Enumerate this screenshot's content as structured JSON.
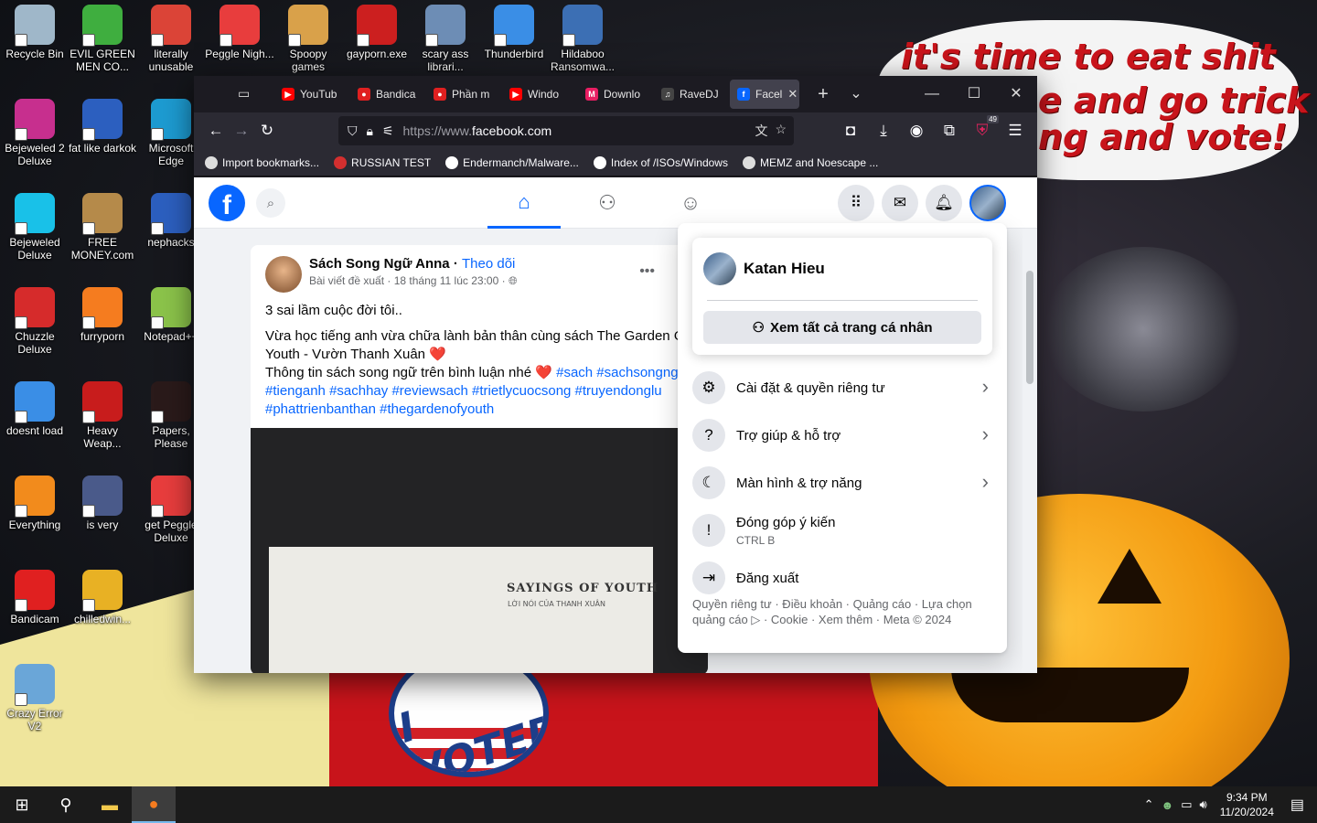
{
  "wallpaper": {
    "lines": [
      "it's time to eat shit",
      "e and go trick",
      "ng and vote!"
    ],
    "voted": "I VOTED"
  },
  "desktop": {
    "icons": [
      {
        "label": "Recycle Bin",
        "icon": "recycle-bin-icon",
        "color": "#9fb7c9"
      },
      {
        "label": "EVIL GREEN MEN CO...",
        "icon": "green-men-icon",
        "color": "#3fae3f"
      },
      {
        "label": "literally unusable",
        "icon": "chrome-icon",
        "color": "#db4437"
      },
      {
        "label": "Peggle Nigh...",
        "icon": "peggle-icon",
        "color": "#e83d3d"
      },
      {
        "label": "Spoopy games",
        "icon": "folder-icon",
        "color": "#d9a14a"
      },
      {
        "label": "gayporn.exe",
        "icon": "flash-icon",
        "color": "#cc1f1f"
      },
      {
        "label": "scary ass librari...",
        "icon": "shield-icon",
        "color": "#6d8db5"
      },
      {
        "label": "Thunderbird",
        "icon": "thunderbird-icon",
        "color": "#3a8ee6"
      },
      {
        "label": "Hildaboo Ransomwa...",
        "icon": "shield-icon",
        "color": "#3c6fb4"
      },
      {
        "label": "Bejeweled 2 Deluxe",
        "icon": "bejeweled-icon",
        "color": "#c72f8e"
      },
      {
        "label": "fat like darkok",
        "icon": "mpi-icon",
        "color": "#2c5fbf"
      },
      {
        "label": "Microsoft Edge",
        "icon": "edge-icon",
        "color": "#1d9bd1"
      },
      {
        "label": "Bejeweled Deluxe",
        "icon": "gem-icon",
        "color": "#19c1e8"
      },
      {
        "label": "FREE MONEY.com",
        "icon": "money-bag-icon",
        "color": "#b58a4a"
      },
      {
        "label": "nephacks",
        "icon": "mpi-icon",
        "color": "#2c5fbf"
      },
      {
        "label": "Chuzzle Deluxe",
        "icon": "chuzzle-icon",
        "color": "#d62b2b"
      },
      {
        "label": "furryporn",
        "icon": "firefox-icon",
        "color": "#f57c1f"
      },
      {
        "label": "Notepad++",
        "icon": "notepad-icon",
        "color": "#8bc34a"
      },
      {
        "label": "doesnt load",
        "icon": "thunderbird-icon",
        "color": "#3a8ee6"
      },
      {
        "label": "Heavy Weap...",
        "icon": "radiation-icon",
        "color": "#c81c1c"
      },
      {
        "label": "Papers, Please",
        "icon": "papers-please-icon",
        "color": "#2a1a1a"
      },
      {
        "label": "Everything",
        "icon": "magnifier-icon",
        "color": "#f28b1c"
      },
      {
        "label": "is very",
        "icon": "mpi-icon",
        "color": "#4a5a8a"
      },
      {
        "label": "get Peggle Deluxe",
        "icon": "peggle-icon",
        "color": "#e83d3d"
      },
      {
        "label": "Bandicam",
        "icon": "record-icon",
        "color": "#e02020"
      },
      {
        "label": "chilledwin...",
        "icon": "windows-logo-icon",
        "color": "#e8b124"
      },
      {
        "label": "Crazy Error V2",
        "icon": "error-window-icon",
        "color": "#6aa6d8"
      }
    ]
  },
  "browser": {
    "tabs": [
      {
        "label": "YouTub",
        "fav": "#ff0000",
        "glyph": "▶"
      },
      {
        "label": "Bandica",
        "fav": "#e02020",
        "glyph": "●"
      },
      {
        "label": "Phần m",
        "fav": "#e02020",
        "glyph": "●"
      },
      {
        "label": "Windo",
        "fav": "#ff0000",
        "glyph": "▶"
      },
      {
        "label": "Downlo",
        "fav": "#e91e63",
        "glyph": "M"
      },
      {
        "label": "RaveDJ",
        "fav": "#444444",
        "glyph": "♫"
      },
      {
        "label": "Facel",
        "fav": "#0866ff",
        "glyph": "f"
      }
    ],
    "url_prefix": "https://www.",
    "url_domain": "facebook.com",
    "badge": "49",
    "bookmarks": [
      {
        "label": "Import bookmarks...",
        "color": "#dddddd"
      },
      {
        "label": "RUSSIAN TEST",
        "color": "#d32f2f"
      },
      {
        "label": "Endermanch/Malware...",
        "color": "#ffffff"
      },
      {
        "label": "Index of /ISOs/Windows",
        "color": "#ffffff"
      },
      {
        "label": "MEMZ and Noescape ...",
        "color": "#dddddd"
      }
    ]
  },
  "facebook": {
    "logo": "f",
    "post": {
      "author": "Sách Song Ngữ Anna",
      "separator": " · ",
      "follow": "Theo dõi",
      "meta": "Bài viết đề xuất · 18 tháng 11 lúc 23:00 ·",
      "line1": "3 sai lầm cuộc đời tôi..",
      "line2": "Vừa học tiếng anh vừa chữa lành bản thân cùng sách The Garden Of Youth - Vườn Thanh Xuân ❤️",
      "line3": "Thông tin sách song ngữ trên bình luận nhé ❤️",
      "tags_a": "#sach #sachsongngu",
      "tags_b": "#tienganh #sachhay #reviewsach #trietlycuocsong #truyendonglu",
      "tags_c": "#phattrienbanthan #thegardenofyouth",
      "book_title": "SAYINGS OF YOUTH",
      "book_sub": "LỜI NÓI CỦA THANH XUÂN"
    },
    "menu": {
      "profile_name": "Katan Hieu",
      "see_all": "Xem tất cả trang cá nhân",
      "items": [
        {
          "label": "Cài đặt & quyền riêng tư",
          "icon": "gear-icon",
          "glyph": "⚙"
        },
        {
          "label": "Trợ giúp & hỗ trợ",
          "icon": "help-icon",
          "glyph": "?"
        },
        {
          "label": "Màn hình & trợ năng",
          "icon": "moon-icon",
          "glyph": "☾"
        },
        {
          "label": "Đóng góp ý kiến",
          "sub": "CTRL B",
          "icon": "feedback-icon",
          "glyph": "!"
        },
        {
          "label": "Đăng xuất",
          "icon": "logout-icon",
          "glyph": "⇥"
        }
      ],
      "footer": "Quyền riêng tư · Điều khoản · Quảng cáo · Lựa chọn quảng cáo ▷ · Cookie · Xem thêm · Meta © 2024"
    }
  },
  "taskbar": {
    "time": "9:34 PM",
    "date": "11/20/2024"
  }
}
